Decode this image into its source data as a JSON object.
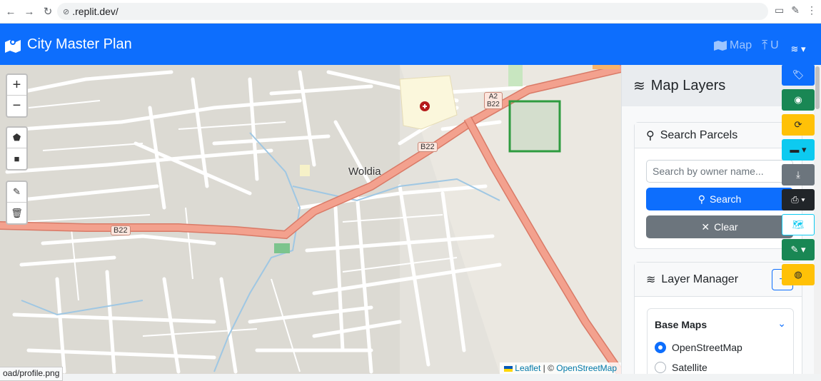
{
  "browser": {
    "url": ".replit.dev/"
  },
  "header": {
    "title": "City Master Plan",
    "nav_map": "Map",
    "nav_upload": "U"
  },
  "map": {
    "city_label": "Woldia",
    "road_labels": [
      "B22",
      "B22",
      "A2",
      "B22"
    ],
    "zoom_in": "+",
    "zoom_out": "−",
    "attribution": {
      "leaflet": "Leaflet",
      "sep": "| ©",
      "osm": "OpenStreetMap"
    }
  },
  "status_text": "oad/profile.png",
  "sidebar": {
    "title": "Map Layers",
    "search": {
      "title": "Search Parcels",
      "placeholder": "Search by owner name...",
      "search_label": "Search",
      "clear_label": "Clear"
    },
    "layer_manager": {
      "title": "Layer Manager",
      "base_maps_title": "Base Maps",
      "options": [
        {
          "label": "OpenStreetMap",
          "selected": true
        },
        {
          "label": "Satellite",
          "selected": false
        }
      ]
    }
  },
  "toolbar": [
    {
      "name": "layers-tool-button",
      "color": "#0d6efd",
      "icon": "layers-icon"
    },
    {
      "name": "tag-tool-button",
      "color": "#0d6efd",
      "icon": "tag-icon"
    },
    {
      "name": "visibility-tool-button",
      "color": "#198754",
      "icon": "eye-icon"
    },
    {
      "name": "refresh-tool-button",
      "color": "#ffc107",
      "icon": "sync-icon"
    },
    {
      "name": "measure-tool-button",
      "color": "#0dcaf0",
      "icon": "ruler-icon"
    },
    {
      "name": "download-tool-button",
      "color": "#6c757d",
      "icon": "download-icon"
    },
    {
      "name": "print-tool-button",
      "color": "#212529",
      "icon": "print-icon"
    },
    {
      "name": "map-tool-button",
      "color": "#ffffff",
      "icon": "map-icon"
    },
    {
      "name": "draw-tool-button",
      "color": "#198754",
      "icon": "pencil-icon"
    },
    {
      "name": "globe-tool-button",
      "color": "#ffc107",
      "icon": "globe-icon"
    }
  ],
  "colors": {
    "primary": "#0d6efd",
    "road": "#f28f7c",
    "parcel": "#2e9b3f"
  }
}
